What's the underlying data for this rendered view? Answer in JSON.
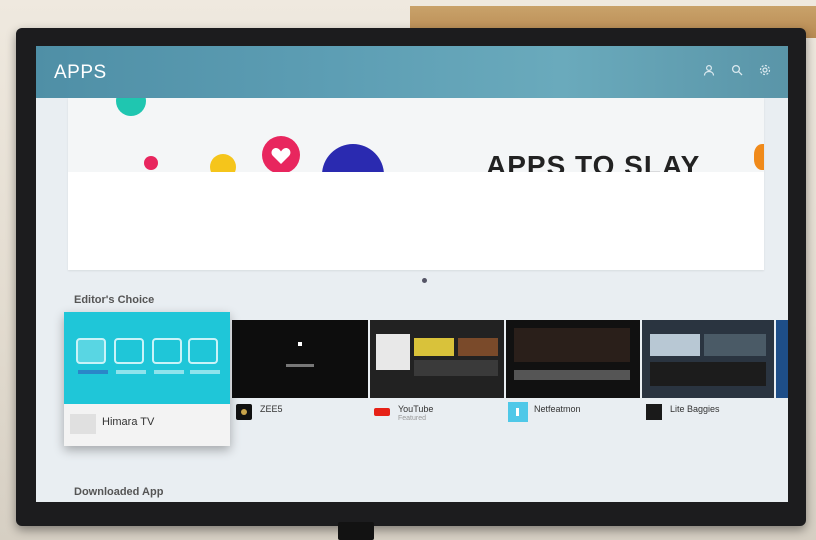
{
  "header": {
    "title": "APPS",
    "icons": [
      "user-icon",
      "search-icon",
      "settings-icon"
    ]
  },
  "banner": {
    "text": "APPS TO SLAY",
    "dot_colors": [
      "#1fc6b0",
      "#e8265e",
      "#f5c51b",
      "#e8265e",
      "#2a2ab0",
      "#f08a1a"
    ]
  },
  "sections": {
    "editors_choice": "Editor's Choice",
    "downloaded": "Downloaded App"
  },
  "apps": [
    {
      "name": "Himara TV",
      "sub": ""
    },
    {
      "name": "ZEE5",
      "sub": ""
    },
    {
      "name": "YouTube",
      "sub": "Featured"
    },
    {
      "name": "Netfeatmon",
      "sub": ""
    },
    {
      "name": "Lite Baggies",
      "sub": ""
    }
  ],
  "colors": {
    "header": "#5d9eb4",
    "focus_tile": "#1fc6d8",
    "youtube_red": "#e62117"
  }
}
